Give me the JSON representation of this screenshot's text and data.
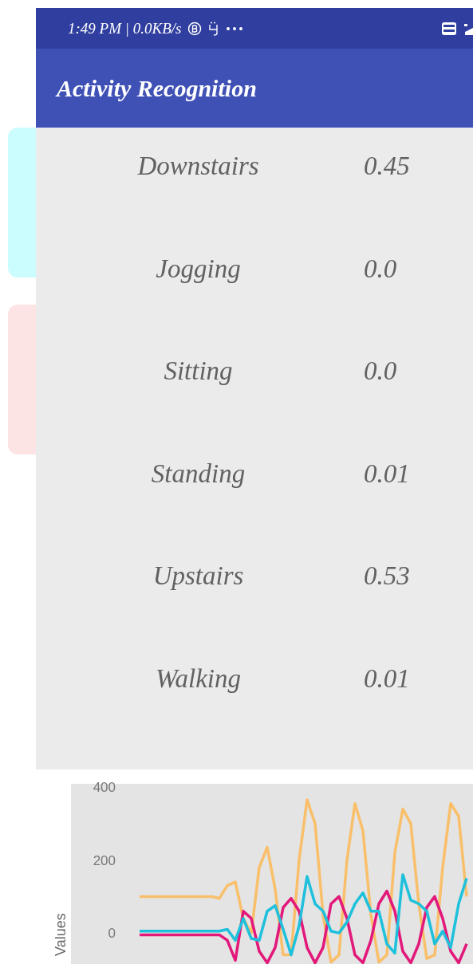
{
  "status_bar": {
    "time_speed": "1:49 PM | 0.0KB/s"
  },
  "app_bar": {
    "title": "Activity Recognition"
  },
  "predictions": [
    {
      "activity": "Downstairs",
      "probability": "0.45"
    },
    {
      "activity": "Jogging",
      "probability": "0.0"
    },
    {
      "activity": "Sitting",
      "probability": "0.0"
    },
    {
      "activity": "Standing",
      "probability": "0.01"
    },
    {
      "activity": "Upstairs",
      "probability": "0.53"
    },
    {
      "activity": "Walking",
      "probability": "0.01"
    }
  ],
  "sensor_chart": {
    "chart_data": {
      "type": "line",
      "ylabel": "Values",
      "yticks": [
        0,
        200,
        400
      ],
      "ylim": [
        -85,
        409
      ],
      "categories": [
        null,
        null,
        null,
        null,
        null,
        null,
        null,
        null,
        null,
        null,
        null,
        null,
        null,
        null,
        null,
        null,
        null,
        null,
        null,
        null,
        null,
        null,
        null,
        null,
        null,
        null,
        null,
        null,
        null,
        null,
        null,
        null,
        null,
        null,
        null,
        null,
        null,
        null,
        null,
        null,
        null,
        null
      ],
      "series": [
        {
          "color": "#f9bf6a",
          "values": [
            100,
            100,
            100,
            100,
            100,
            100,
            100,
            100,
            100,
            100,
            95,
            130,
            140,
            40,
            0,
            180,
            235,
            120,
            -60,
            -60,
            200,
            365,
            300,
            50,
            -80,
            -60,
            200,
            355,
            280,
            50,
            -80,
            -60,
            220,
            340,
            300,
            80,
            -70,
            -60,
            180,
            355,
            320,
            100
          ]
        },
        {
          "color": "#e2187a",
          "values": [
            -5,
            -5,
            -5,
            -5,
            -5,
            -5,
            -5,
            -5,
            -5,
            -5,
            -5,
            -20,
            -75,
            60,
            40,
            -50,
            -82,
            -40,
            70,
            95,
            60,
            -40,
            -82,
            -40,
            80,
            100,
            40,
            -60,
            -82,
            -20,
            80,
            115,
            60,
            -50,
            -82,
            -30,
            70,
            100,
            40,
            -50,
            -82,
            -30
          ]
        },
        {
          "color": "#1ec0dc",
          "values": [
            5,
            5,
            5,
            5,
            5,
            5,
            5,
            5,
            5,
            5,
            5,
            10,
            -20,
            40,
            -15,
            -20,
            60,
            75,
            10,
            -60,
            20,
            155,
            80,
            60,
            5,
            0,
            30,
            80,
            110,
            60,
            60,
            -30,
            -55,
            160,
            90,
            80,
            60,
            -30,
            5,
            -40,
            80,
            150
          ]
        }
      ]
    }
  }
}
